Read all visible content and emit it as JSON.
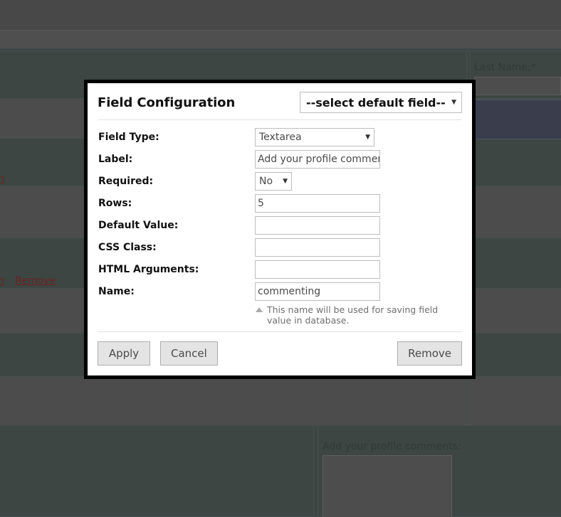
{
  "background": {
    "last_name_label": "Last Name:*",
    "comments_label": "Add your profile comments:",
    "link_edit_partial": "rn",
    "link_remove": "Remove",
    "link_edit_partial2": "rn"
  },
  "dialog": {
    "title": "Field Configuration",
    "default_field_select": {
      "value": "--select default field--",
      "caret_icon": "chevron-down-icon"
    },
    "fields": [
      {
        "label": "Field Type:",
        "control": "select",
        "value": "Textarea"
      },
      {
        "label": "Label:",
        "control": "text",
        "value": "Add your profile comments:"
      },
      {
        "label": "Required:",
        "control": "select",
        "value": "No"
      },
      {
        "label": "Rows:",
        "control": "text",
        "value": "5"
      },
      {
        "label": "Default Value:",
        "control": "text",
        "value": ""
      },
      {
        "label": "CSS Class:",
        "control": "text",
        "value": ""
      },
      {
        "label": "HTML Arguments:",
        "control": "text",
        "value": ""
      },
      {
        "label": "Name:",
        "control": "text",
        "value": "commenting"
      }
    ],
    "name_hint": "This name will be used for saving field value in database.",
    "buttons": {
      "apply": "Apply",
      "cancel": "Cancel",
      "remove": "Remove"
    }
  },
  "colors": {
    "overlay": "#4c4c4c",
    "row_alt": "#3d4643",
    "dialog_border": "#000000",
    "dialog_bg": "#ffffff",
    "link": "#6b2222",
    "highlight_row": "#3a3e4c"
  }
}
